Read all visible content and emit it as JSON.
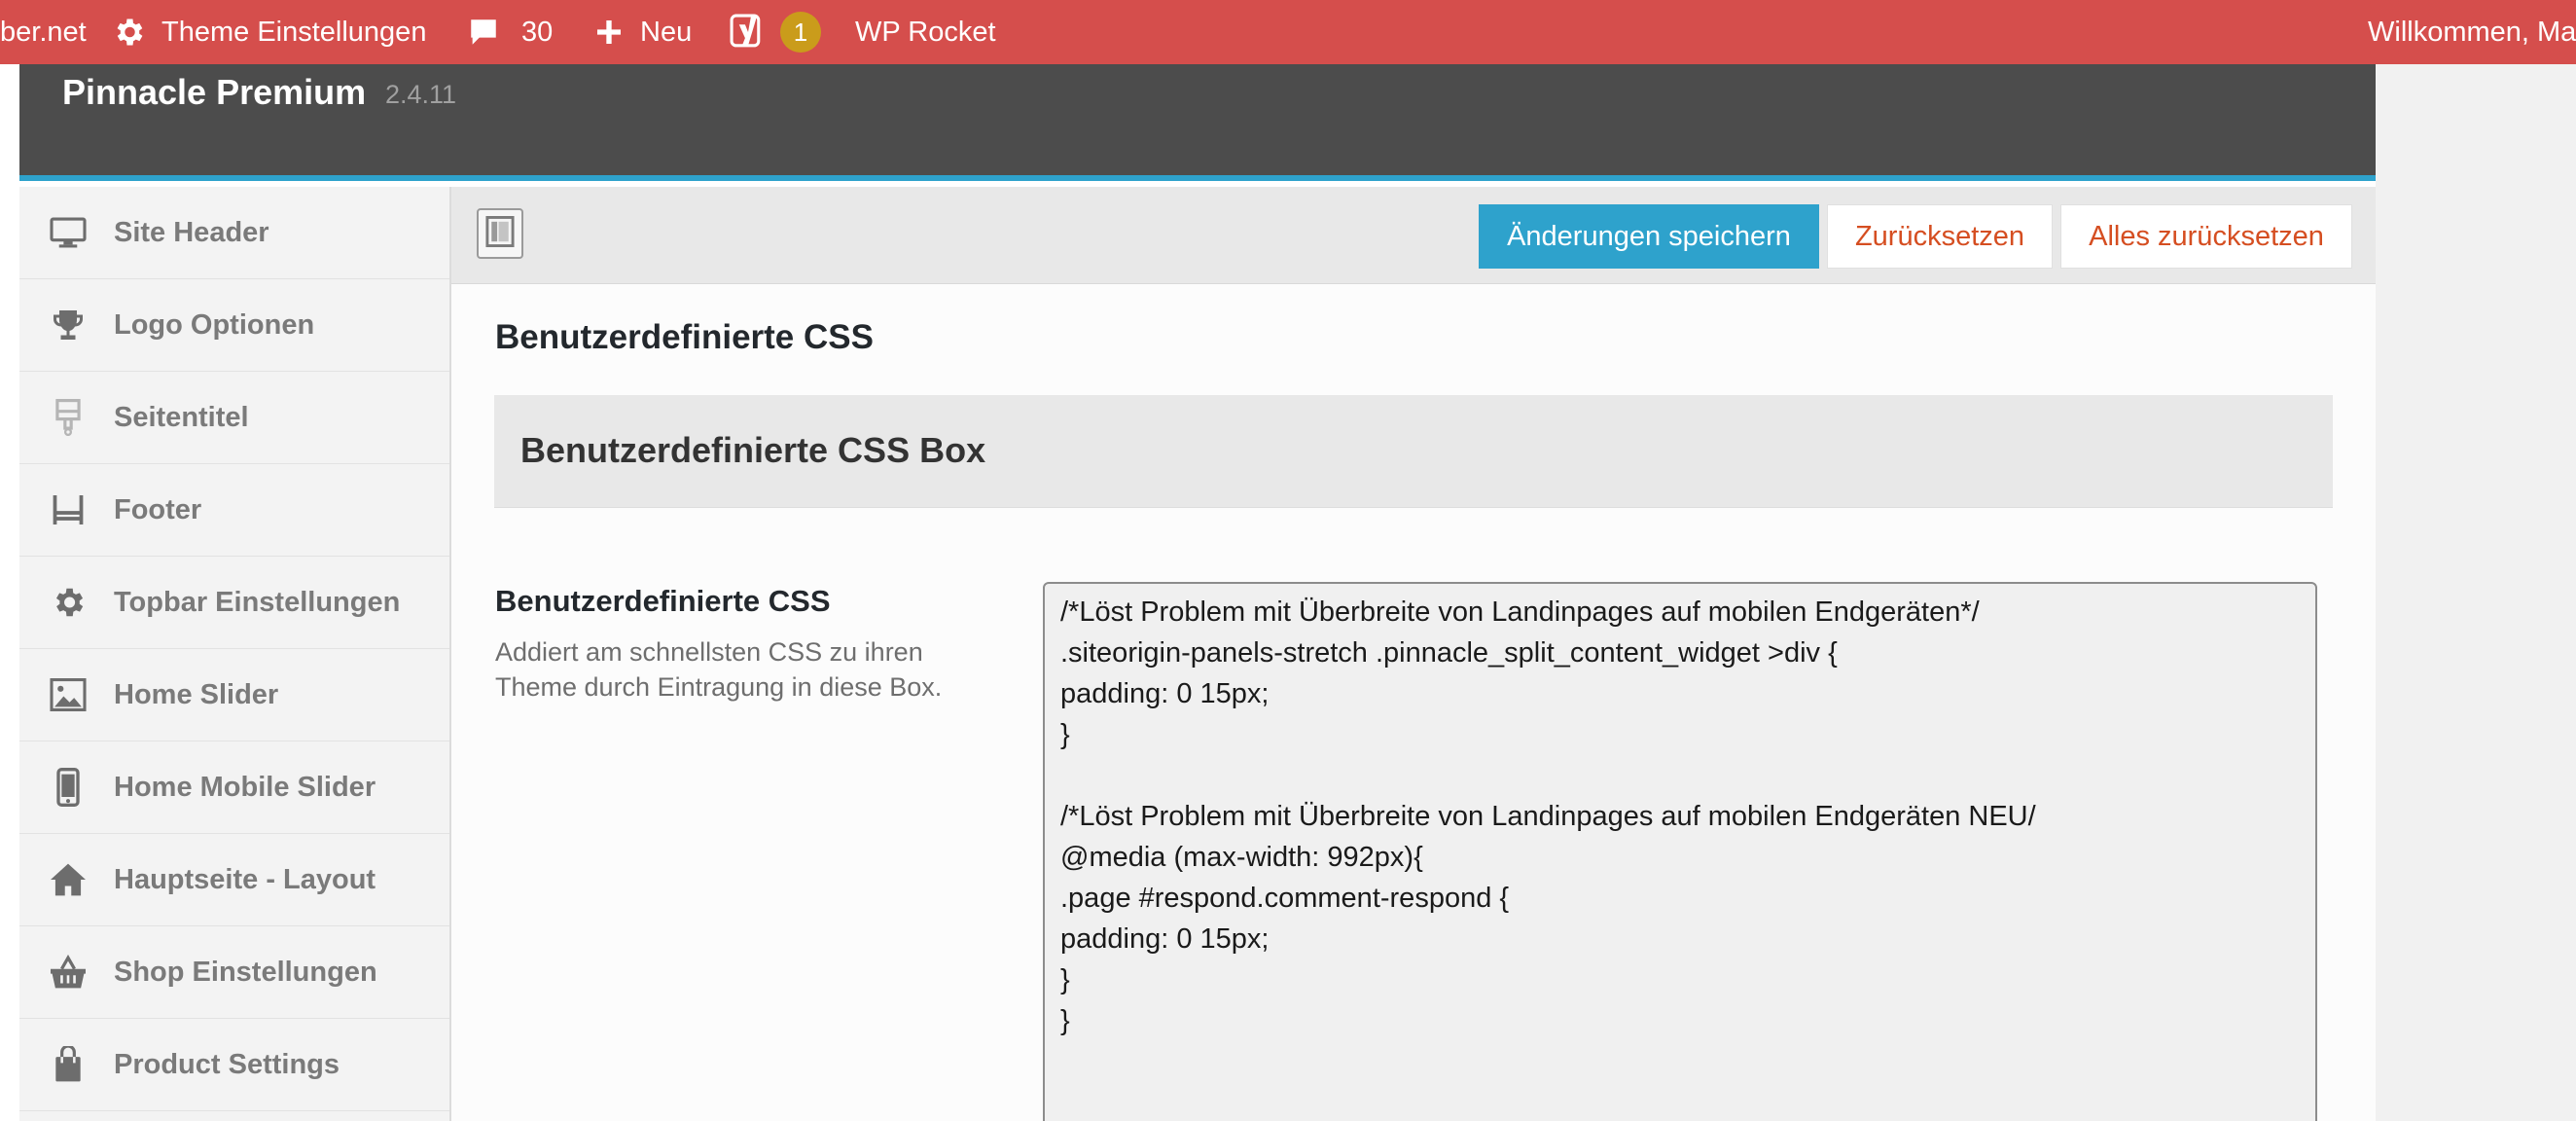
{
  "admin_bar": {
    "site_name": "ber.net",
    "theme_settings": "Theme Einstellungen",
    "comments_count": "30",
    "new_label": "Neu",
    "yoast_count": "1",
    "wp_rocket": "WP Rocket",
    "welcome": "Willkommen, Ma"
  },
  "theme": {
    "title": "Pinnacle Premium",
    "version": "2.4.11"
  },
  "sidebar": {
    "items": [
      {
        "label": "Site Header",
        "icon": "monitor-icon"
      },
      {
        "label": "Logo Optionen",
        "icon": "trophy-icon"
      },
      {
        "label": "Seitentitel",
        "icon": "paintbrush-icon"
      },
      {
        "label": "Footer",
        "icon": "footer-icon"
      },
      {
        "label": "Topbar Einstellungen",
        "icon": "gear-icon"
      },
      {
        "label": "Home Slider",
        "icon": "image-icon"
      },
      {
        "label": "Home Mobile Slider",
        "icon": "mobile-icon"
      },
      {
        "label": "Hauptseite - Layout",
        "icon": "home-icon"
      },
      {
        "label": "Shop Einstellungen",
        "icon": "basket-icon"
      },
      {
        "label": "Product Settings",
        "icon": "shopping-bag-icon"
      }
    ]
  },
  "toolbar": {
    "save_label": "Änderungen speichern",
    "reset_label": "Zurücksetzen",
    "reset_all_label": "Alles zurücksetzen"
  },
  "section": {
    "title": "Benutzerdefinierte CSS",
    "box_title": "Benutzerdefinierte CSS Box"
  },
  "field": {
    "title": "Benutzerdefinierte CSS",
    "description": "Addiert am schnellsten CSS zu ihren Theme durch Eintragung in diese Box.",
    "value": "/*Löst Problem mit Überbreite von Landinpages auf mobilen Endgeräten*/\n.siteorigin-panels-stretch .pinnacle_split_content_widget >div {\npadding: 0 15px;\n}\n\n/*Löst Problem mit Überbreite von Landinpages auf mobilen Endgeräten NEU/\n@media (max-width: 992px){\n.page #respond.comment-respond {\npadding: 0 15px;\n}\n}"
  },
  "colors": {
    "admin_bar": "#d54e4c",
    "accent": "#2ea2cc",
    "danger_text": "#d54e21",
    "header_bg": "#4c4c4c"
  }
}
